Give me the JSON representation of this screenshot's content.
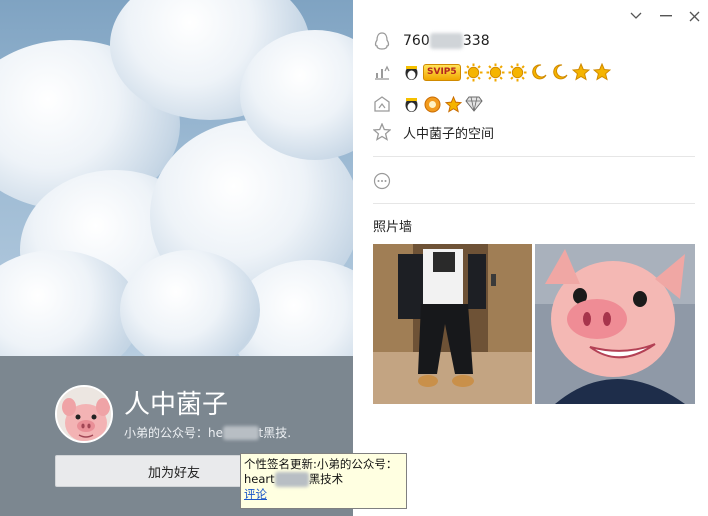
{
  "profile": {
    "nickname": "人中菌子",
    "signature_prefix": "小弟的公众号：he",
    "signature_suffix": "t黑技.",
    "add_friend_label": "加为好友"
  },
  "tooltip": {
    "line1": "个性签名更新:小弟的公众号：",
    "line2_prefix": "heart",
    "line2_suffix": "黑技术",
    "link_label": "评论"
  },
  "info": {
    "qq_prefix": "760",
    "qq_suffix": "338",
    "level_badges": [
      "sun-icon",
      "sun-icon",
      "sun-icon",
      "moon-icon",
      "moon-icon",
      "star-icon",
      "star-icon"
    ],
    "svip_label": "SVIP5",
    "space_label": "人中菌子的空间"
  },
  "photo_wall": {
    "title": "照片墙"
  },
  "colors": {
    "bottom_panel": "#7c8790",
    "tooltip_bg": "#ffffe1",
    "link": "#1a56c8"
  }
}
